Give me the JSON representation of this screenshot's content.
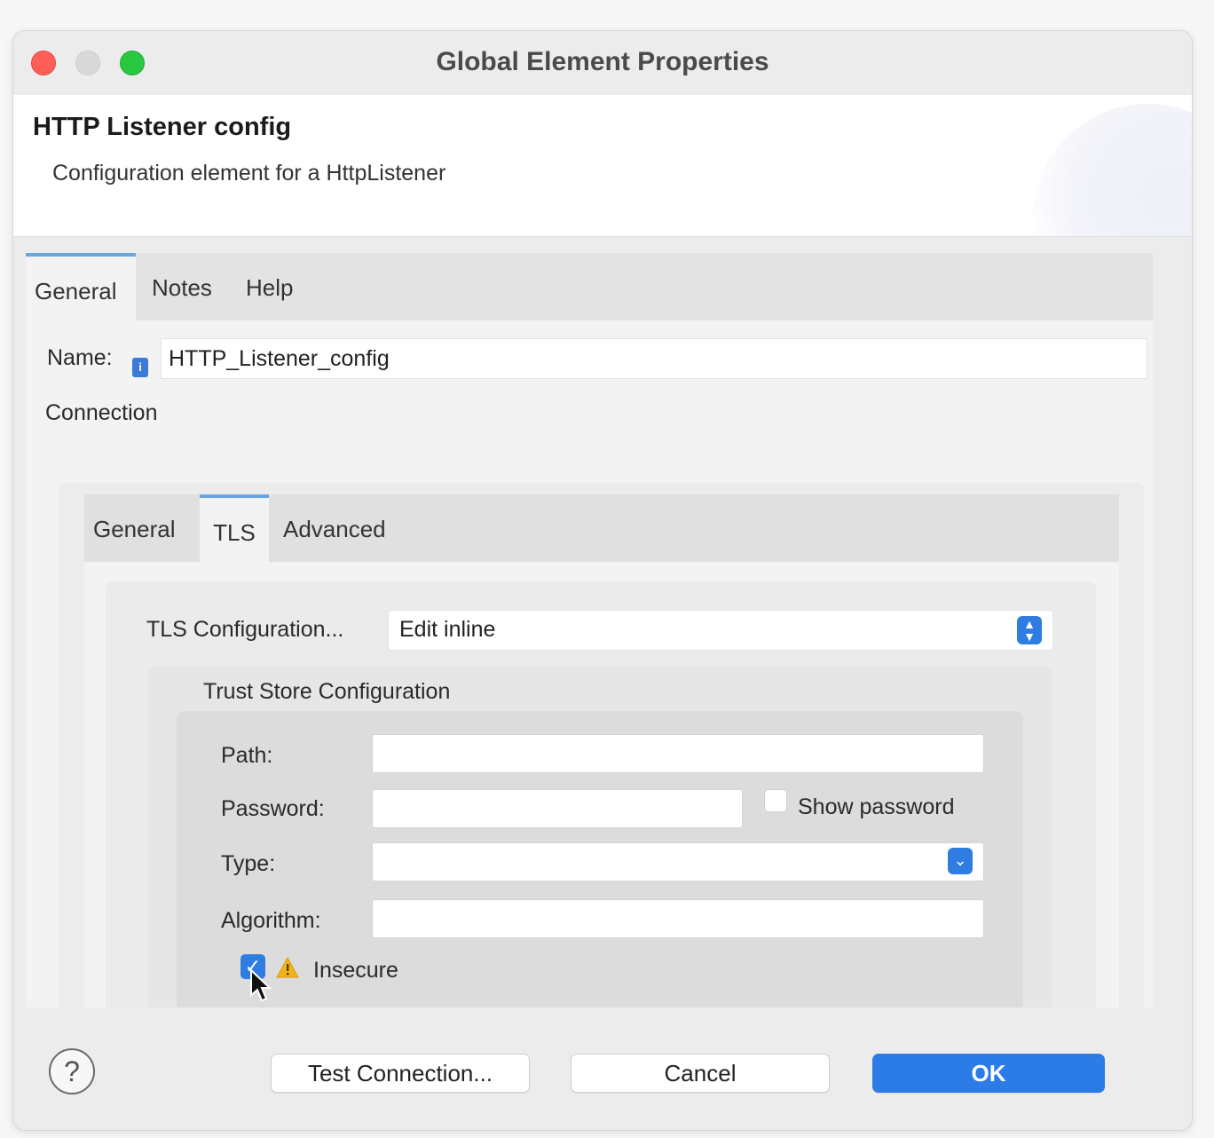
{
  "window": {
    "title": "Global Element Properties"
  },
  "header": {
    "title": "HTTP Listener config",
    "subtitle": "Configuration element for a HttpListener"
  },
  "tabs": [
    {
      "label": "General",
      "active": true
    },
    {
      "label": "Notes",
      "active": false
    },
    {
      "label": "Help",
      "active": false
    }
  ],
  "general": {
    "name_label": "Name:",
    "name_value": "HTTP_Listener_config",
    "connection_label": "Connection"
  },
  "connection_tabs": [
    {
      "label": "General",
      "active": false
    },
    {
      "label": "TLS",
      "active": true
    },
    {
      "label": "Advanced",
      "active": false
    }
  ],
  "tls": {
    "config_label": "TLS Configuration...",
    "config_value": "Edit inline",
    "trust_store": {
      "title": "Trust Store Configuration",
      "path_label": "Path:",
      "path_value": "",
      "password_label": "Password:",
      "password_value": "",
      "show_password_label": "Show password",
      "show_password_checked": false,
      "type_label": "Type:",
      "type_value": "",
      "algorithm_label": "Algorithm:",
      "algorithm_value": "",
      "insecure_label": "Insecure",
      "insecure_checked": true
    }
  },
  "footer": {
    "help_glyph": "?",
    "test_connection_label": "Test Connection...",
    "cancel_label": "Cancel",
    "ok_label": "OK"
  },
  "colors": {
    "accent": "#2b7ce6",
    "tab_indicator": "#6aa6de",
    "close": "#ff5f57",
    "zoom": "#28c840",
    "warning": "#f2b21c"
  }
}
